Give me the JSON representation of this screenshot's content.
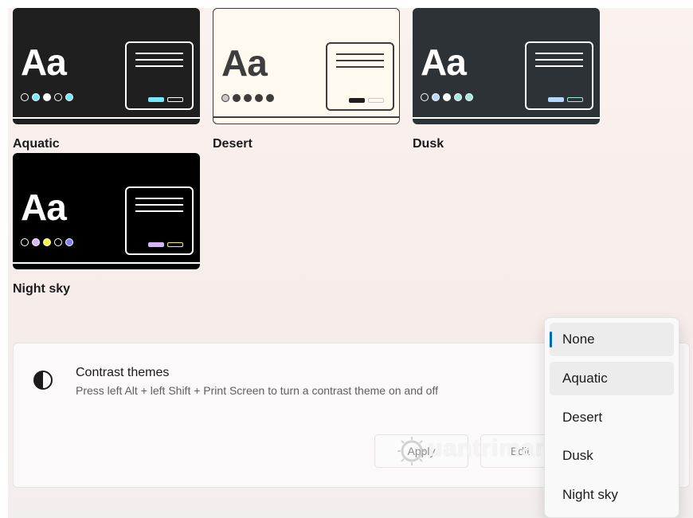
{
  "themes": [
    {
      "name": "Aquatic",
      "bg": "#1f1f1f",
      "fg": "#ffffff",
      "taskbar": "#ffffff",
      "dots": [
        "#1f1f1f",
        "#75e9fc",
        "#ffffff",
        "#1f1f1f",
        "#75e9fc"
      ],
      "btn1": "#75e9fc",
      "btn2": "#ffffff"
    },
    {
      "name": "Desert",
      "bg": "#fff9f0",
      "fg": "#3d3d3d",
      "taskbar": "#3d3d3d",
      "dots": [
        "#c8c8c8",
        "#3d3d3d",
        "#3d3d3d",
        "#3d3d3d",
        "#3d3d3d"
      ],
      "btn1": "#1f1f1f",
      "btn2": "#c8c8c8"
    },
    {
      "name": "Dusk",
      "bg": "#2d3236",
      "fg": "#ffffff",
      "taskbar": "#ffffff",
      "dots": [
        "#2d3236",
        "#b6d7fe",
        "#ffffff",
        "#a2e9dd",
        "#a2e9dd"
      ],
      "btn1": "#b6d7fe",
      "btn2": "#a2e9dd"
    },
    {
      "name": "Night sky",
      "bg": "#000000",
      "fg": "#ffffff",
      "taskbar": "#ffffff",
      "dots": [
        "#000000",
        "#d6b4fd",
        "#fff33d",
        "#000000",
        "#8080ff"
      ],
      "btn1": "#d6b4fd",
      "btn2": "#fff33d"
    }
  ],
  "contrast": {
    "title": "Contrast themes",
    "description": "Press left Alt + left Shift + Print Screen to turn a contrast theme on and off",
    "apply_label": "Apply",
    "edit_label": "Edit",
    "icon": "contrast-icon"
  },
  "dropdown": {
    "options": [
      "None",
      "Aquatic",
      "Desert",
      "Dusk",
      "Night sky"
    ],
    "selected": "None",
    "hovered": "Aquatic",
    "accent": "#0067c0"
  },
  "watermark": "uantrimang"
}
